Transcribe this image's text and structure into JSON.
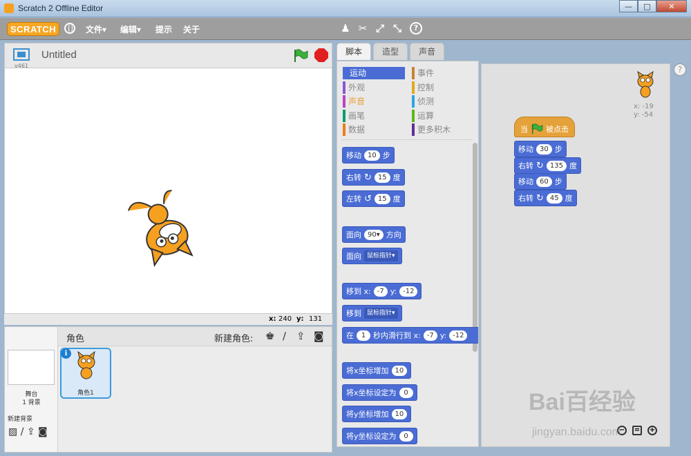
{
  "window": {
    "title": "Scratch 2 Offline Editor",
    "minimize": "—",
    "maximize": "□",
    "close": "✕"
  },
  "menubar": {
    "logo": "SCRATCH",
    "file": "文件▾",
    "edit": "编辑▾",
    "tips": "提示",
    "about": "关于"
  },
  "stage": {
    "version": "v461",
    "project_title": "Untitled",
    "x_label": "x:",
    "x_value": "240",
    "y_label": "y:",
    "y_value": "131"
  },
  "sprites_panel": {
    "sprites_label": "角色",
    "new_sprite_label": "新建角色:",
    "stage_label": "舞台",
    "backdrop_count": "1 背景",
    "new_backdrop_label": "新建背景",
    "sprite_name": "角色1"
  },
  "tabs": [
    "脚本",
    "造型",
    "声音"
  ],
  "categories": {
    "motion": "运动",
    "looks": "外观",
    "sound": "声音",
    "pen": "画笔",
    "data": "数据",
    "events": "事件",
    "control": "控制",
    "sensing": "侦测",
    "operators": "运算",
    "more": "更多积木"
  },
  "palette_blocks": {
    "move": {
      "label": "移动",
      "value": "10",
      "unit": "步"
    },
    "turn_right": {
      "label": "右转",
      "value": "15",
      "unit": "度"
    },
    "turn_left": {
      "label": "左转",
      "value": "15",
      "unit": "度"
    },
    "point_dir": {
      "label": "面向",
      "value": "90▾",
      "unit": "方向"
    },
    "point_towards": {
      "label": "面向",
      "dropdown": "鼠标指针▾"
    },
    "goto_xy": {
      "label": "移到 x:",
      "x": "-7",
      "y_label": "y:",
      "y": "-12"
    },
    "goto": {
      "label": "移到",
      "dropdown": "鼠标指针▾"
    },
    "glide": {
      "label": "在",
      "secs": "1",
      "mid": "秒内滑行到 x:",
      "x": "-7",
      "y_label": "y:",
      "y": "-12"
    },
    "change_x": {
      "label": "将x坐标增加",
      "value": "10"
    },
    "set_x": {
      "label": "将x坐标设定为",
      "value": "0"
    },
    "change_y": {
      "label": "将y坐标增加",
      "value": "10"
    },
    "set_y": {
      "label": "将y坐标设定为",
      "value": "0"
    }
  },
  "script": {
    "hat_when": "当",
    "hat_clicked": "被点击",
    "blocks": [
      {
        "label": "移动",
        "value": "30",
        "unit": "步"
      },
      {
        "label": "右转",
        "value": "135",
        "unit": "度"
      },
      {
        "label": "移动",
        "value": "60",
        "unit": "步"
      },
      {
        "label": "右转",
        "value": "45",
        "unit": "度"
      }
    ],
    "sprite_x": "x: -19",
    "sprite_y": "y: -54"
  },
  "watermark": {
    "main": "Bai百经验",
    "sub": "jingyan.baidu.com"
  },
  "colors": {
    "motion": "#4a6cd4",
    "looks": "#8a55d7",
    "sound": "#bb42c3",
    "pen": "#0e9a6c",
    "data": "#ee7d16",
    "events": "#c88330",
    "control": "#e1a91a",
    "sensing": "#2ca5e2",
    "operators": "#5cb712",
    "more": "#632d99"
  }
}
